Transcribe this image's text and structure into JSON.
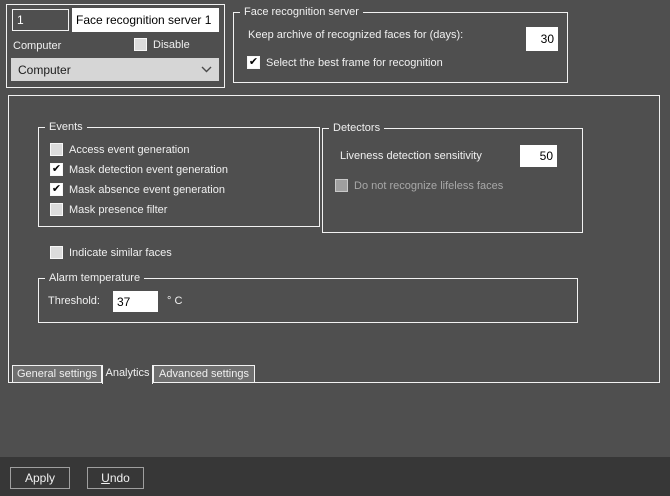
{
  "colors": {
    "background": "#4f4f4f",
    "footer_bar": "#373737",
    "border": "#f2f2f2",
    "tab_inactive": "#6f6f6f",
    "input_bg": "#ffffff",
    "input_text": "#000000",
    "dropdown_bg": "#d6d6d6",
    "text": "#f0f0f0",
    "dim_text": "#a8a8a8"
  },
  "identity": {
    "id_value": "1",
    "name_value": "Face recognition server 1",
    "computer_label": "Computer",
    "disable_label": "Disable",
    "disable_checked": false,
    "computer_select_value": "Computer"
  },
  "server_group": {
    "title": "Face recognition server",
    "archive_label": "Keep archive of recognized faces for (days):",
    "archive_value": "30",
    "best_frame_label": "Select the best frame for recognition",
    "best_frame_checked": true
  },
  "events_group": {
    "title": "Events",
    "items": [
      {
        "label": "Access event generation",
        "checked": false
      },
      {
        "label": "Mask detection event generation",
        "checked": true
      },
      {
        "label": "Mask absence event generation",
        "checked": true
      },
      {
        "label": "Mask presence filter",
        "checked": false
      }
    ]
  },
  "detectors_group": {
    "title": "Detectors",
    "sensitivity_label": "Liveness detection sensitivity",
    "sensitivity_value": "50",
    "lifeless_label": "Do not recognize lifeless faces",
    "lifeless_checked": false
  },
  "similar_faces": {
    "label": "Indicate similar faces",
    "checked": false
  },
  "alarm_group": {
    "title": "Alarm temperature",
    "threshold_label": "Threshold:",
    "threshold_value": "37",
    "unit": "° C"
  },
  "tabs": [
    {
      "label": "General settings",
      "active": false
    },
    {
      "label": "Analytics",
      "active": true
    },
    {
      "label": "Advanced settings",
      "active": false
    }
  ],
  "footer": {
    "apply_label": "Apply",
    "undo_accel": "U",
    "undo_rest": "ndo"
  }
}
